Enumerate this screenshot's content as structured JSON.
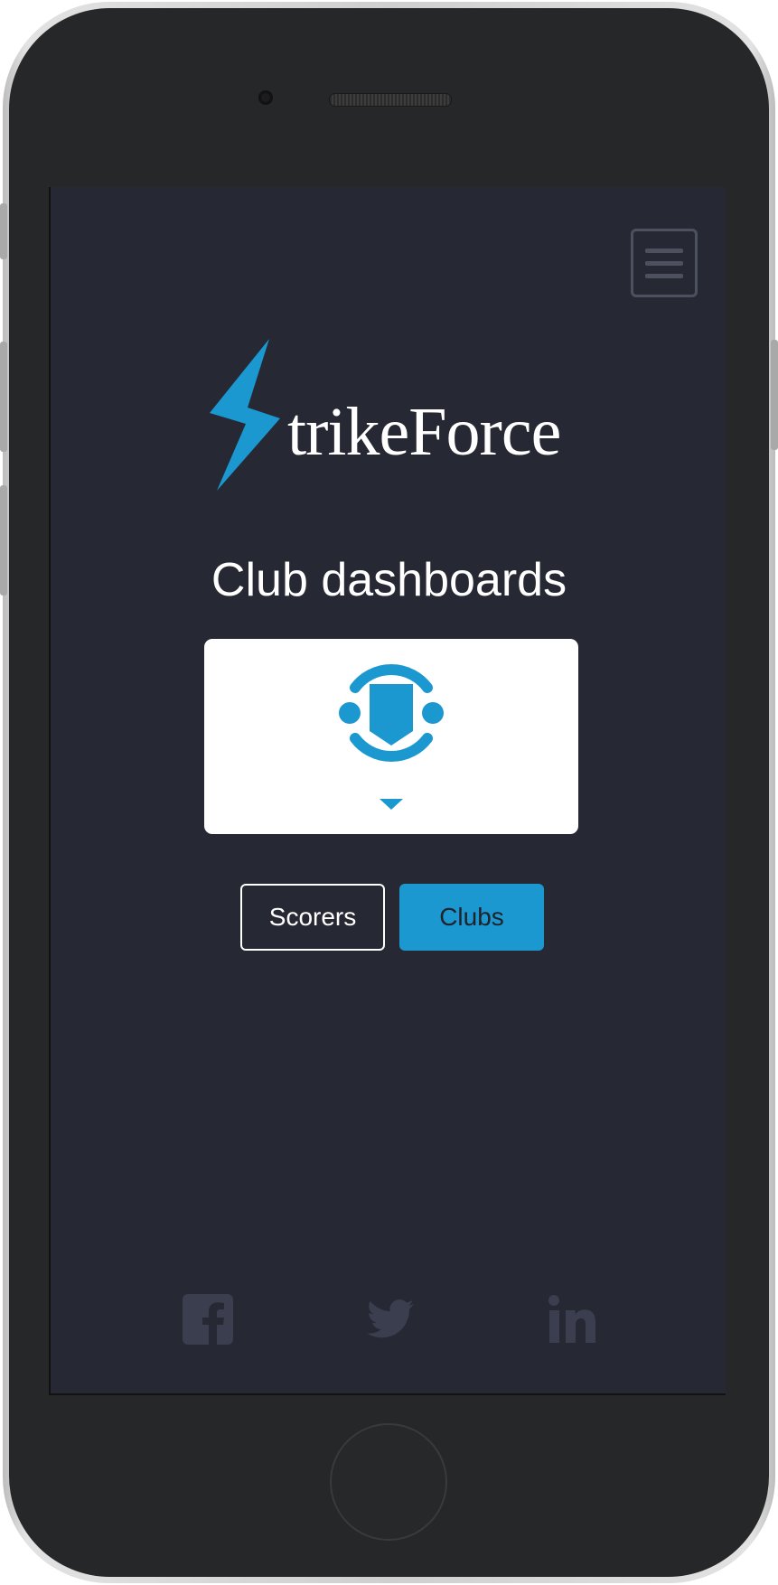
{
  "brand": {
    "logo_text": "trikeForce",
    "accent_color": "#1c98d1",
    "background_color": "#262833"
  },
  "header": {
    "menu_icon": "hamburger-menu-icon"
  },
  "main": {
    "title": "Club dashboards",
    "club_select": {
      "selected_icon": "club-crest-icon",
      "dropdown_icon": "caret-down-icon"
    },
    "buttons": [
      {
        "label": "Scorers",
        "active": false
      },
      {
        "label": "Clubs",
        "active": true
      }
    ]
  },
  "footer": {
    "social_icons": [
      "facebook-icon",
      "twitter-icon",
      "linkedin-icon"
    ]
  }
}
